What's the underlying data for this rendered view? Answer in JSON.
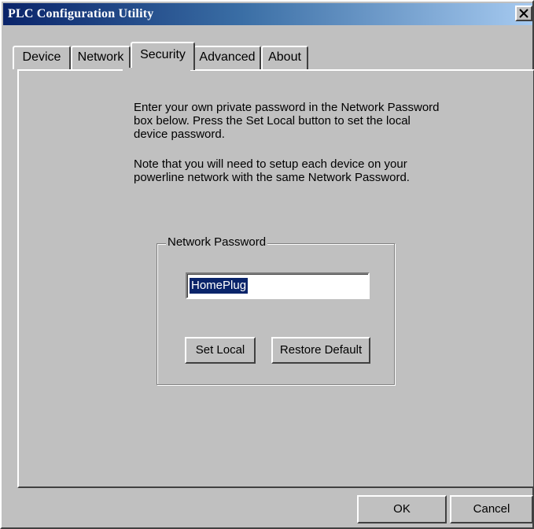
{
  "window": {
    "title": "PLC Configuration Utility",
    "close_glyph": "✕"
  },
  "tabs": [
    {
      "label": "Device",
      "active": false
    },
    {
      "label": "Network",
      "active": false
    },
    {
      "label": "Security",
      "active": true
    },
    {
      "label": "Advanced",
      "active": false
    },
    {
      "label": "About",
      "active": false
    }
  ],
  "security": {
    "intro_text": "Enter your own private password in the Network Password box below. Press the Set Local button to set the local device password.",
    "note_text": "Note that you will need to setup each device on your powerline network with the same Network Password.",
    "group_title": "Network Password",
    "password_value": "HomePlug",
    "set_local_label": "Set Local",
    "restore_default_label": "Restore Default"
  },
  "footer": {
    "ok_label": "OK",
    "cancel_label": "Cancel"
  },
  "colors": {
    "window_bg": "#c0c0c0",
    "title_gradient_start": "#0a246a",
    "title_gradient_end": "#a6caf0",
    "selection_bg": "#0a246a"
  }
}
